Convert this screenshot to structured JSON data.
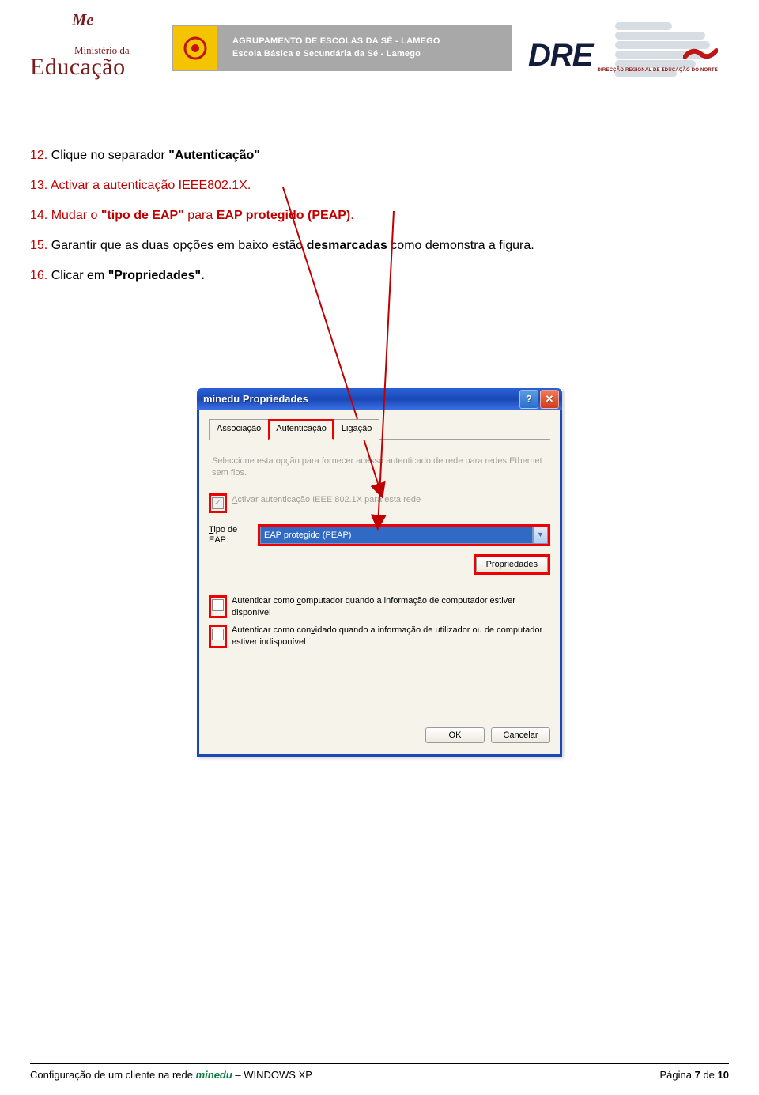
{
  "header": {
    "ministerio_sub": "Ministério da",
    "ministerio_main": "Educação",
    "banner_line1": "AGRUPAMENTO DE ESCOLAS DA SÉ - LAMEGO",
    "banner_line2": "Escola Básica e Secundária da Sé - Lamego",
    "dren_text": "DRE",
    "dren_sub": "DIRECÇÃO REGIONAL DE EDUCAÇÃO DO NORTE"
  },
  "instructions": {
    "i12": {
      "num": "12.",
      "pre": " Clique no separador ",
      "bold": "\"Autenticação\""
    },
    "i13": {
      "num": "13.",
      "text": " Activar a autenticação IEEE802.1X."
    },
    "i14": {
      "num": "14.",
      "pre": " Mudar o ",
      "bold1": "\"tipo de EAP\"",
      "mid": " para ",
      "bold2": "EAP protegido (PEAP)",
      "post": "."
    },
    "i15": {
      "num": "15.",
      "pre": " Garantir que as duas opções em baixo estão ",
      "bold": "desmarcadas",
      "post": " como demonstra a figura."
    },
    "i16": {
      "num": "16.",
      "pre": " Clicar em ",
      "bold": "\"Propriedades\"."
    }
  },
  "dialog": {
    "title": "minedu Propriedades",
    "tabs": {
      "t1": "Associação",
      "t2": "Autenticação",
      "t3": "Ligação"
    },
    "hint": "Seleccione esta opção para fornecer acesso autenticado de rede para redes Ethernet sem fios.",
    "chk_8021x": "Activar autenticação IEEE 802.1X para esta rede",
    "eap_label": "Tipo de EAP:",
    "eap_value": "EAP protegido (PEAP)",
    "btn_props": "Propriedades",
    "chk_comp": "Autenticar como computador quando a informação de computador estiver disponível",
    "chk_guest": "Autenticar como convidado quando a informação de utilizador ou de computador estiver indisponível",
    "btn_ok": "OK",
    "btn_cancel": "Cancelar"
  },
  "footer": {
    "left_pre": "Configuração de um cliente na rede ",
    "left_em": "minedu",
    "left_post": " – WINDOWS XP",
    "right_pre": "Página ",
    "right_n": "7",
    "right_mid": " de ",
    "right_tot": "10"
  }
}
